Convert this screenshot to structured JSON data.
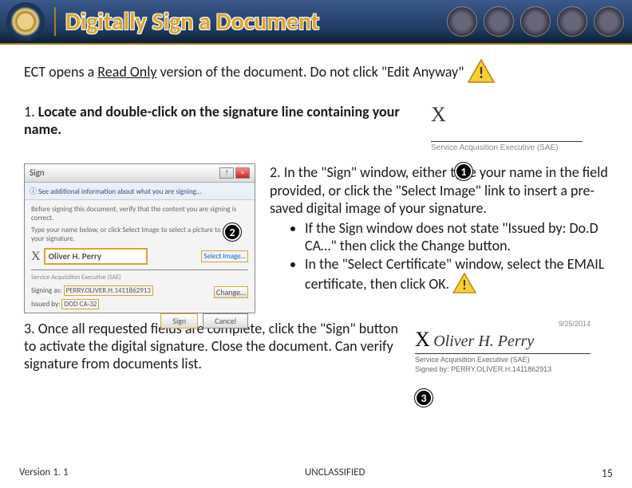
{
  "header": {
    "title": "Digitally Sign a Document"
  },
  "intro": {
    "t1": "ECT opens a ",
    "u": "Read Only",
    "t2": " version of the document.  Do not click \"Edit Anyway\""
  },
  "step1": {
    "prefix": "1. ",
    "text": "Locate and double-click on the signature line containing your name."
  },
  "sigbox1": {
    "x": "X",
    "role": "Service Acquisition Executive (SAE)"
  },
  "dialog": {
    "title": "Sign",
    "info": "ⓘ See additional information about what you are signing…",
    "line1": "Before signing this document, verify that the content you are signing is correct.",
    "line2": "Type your name below, or click Select Image to select a picture to use as your signature.",
    "x": "X",
    "name": "Oliver H. Perry",
    "selectimg": "Select Image…",
    "role": "Service Acquisition Executive (SAE)",
    "signas": "Signing as: ",
    "cert": "PERRY.OLIVER.H.1411862913",
    "issued": "Issued by: ",
    "ca": "DOD CA-32",
    "change": "Change…",
    "sign": "Sign",
    "cancel": "Cancel"
  },
  "step2": {
    "main": "2. In the \"Sign\" window, either type your name in the field provided, or click the \"Select Image\" link to insert a pre-saved digital image of your signature.",
    "b1": "If the Sign window does not state \"Issued by: Do.D CA…\" then click the Change button.",
    "b2": "In the \"Select Certificate\" window, select the EMAIL certificate, then click OK."
  },
  "step3": {
    "text": "3. Once all requested fields are complete, click the \"Sign\" button to activate the digital signature.  Close the document.  Can verify signature from documents list."
  },
  "signed": {
    "date": "9/25/2014",
    "x": "X",
    "name": "Oliver H. Perry",
    "role": "Service Acquisition Executive (SAE)",
    "by": "Signed by:  PERRY.OLIVER.H.1411862913"
  },
  "callouts": {
    "c1": "1",
    "c2": "2",
    "c3": "3"
  },
  "footer": {
    "left": "Version 1. 1",
    "center": "UNCLASSIFIED",
    "right": "15"
  }
}
